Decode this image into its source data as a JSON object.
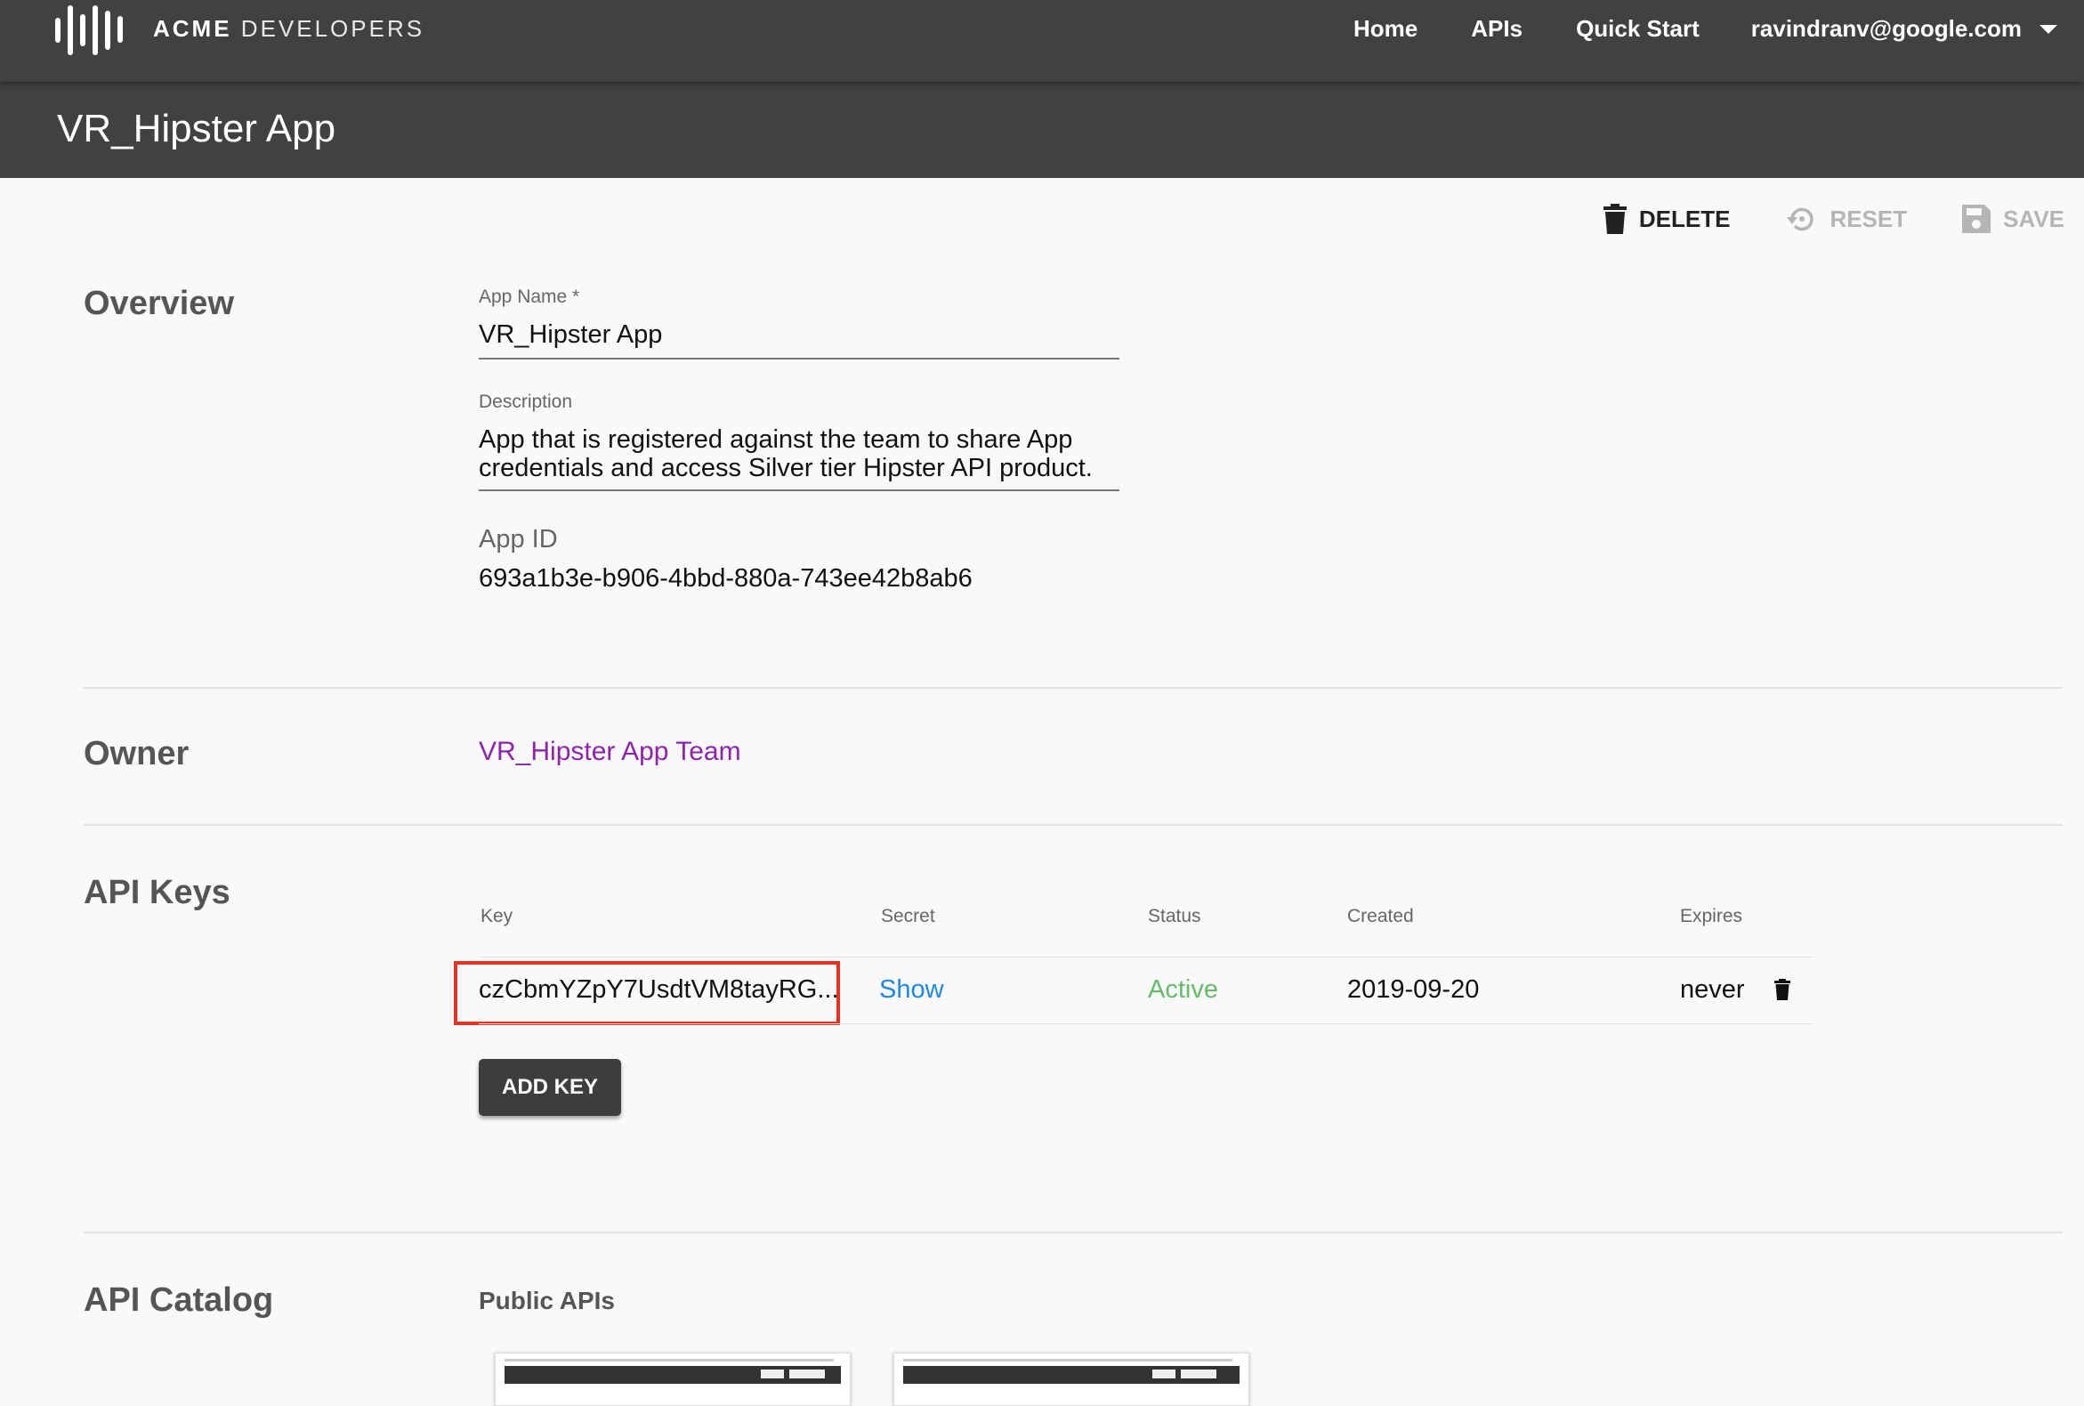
{
  "header": {
    "brand_bold": "ACME",
    "brand_thin": "DEVELOPERS",
    "nav": [
      "Home",
      "APIs",
      "Quick Start"
    ],
    "user_email": "ravindranv@google.com"
  },
  "page": {
    "title": "VR_Hipster App"
  },
  "actions": {
    "delete": "DELETE",
    "reset": "RESET",
    "save": "SAVE"
  },
  "overview": {
    "section_label": "Overview",
    "app_name_label": "App Name *",
    "app_name_value": "VR_Hipster App",
    "description_label": "Description",
    "description_line1": "App that is registered against the team to share App",
    "description_line2": "credentials and access Silver tier Hipster API product.",
    "app_id_label": "App ID",
    "app_id_value": "693a1b3e-b906-4bbd-880a-743ee42b8ab6"
  },
  "owner": {
    "section_label": "Owner",
    "team_link": "VR_Hipster App Team"
  },
  "api_keys": {
    "section_label": "API Keys",
    "columns": [
      "Key",
      "Secret",
      "Status",
      "Created",
      "Expires"
    ],
    "rows": [
      {
        "key": "czCbmYZpY7UsdtVM8tayRG...",
        "secret": "Show",
        "status": "Active",
        "created": "2019-09-20",
        "expires": "never"
      }
    ],
    "add_key_label": "ADD KEY"
  },
  "api_catalog": {
    "section_label": "API Catalog",
    "public_apis_label": "Public APIs"
  },
  "colors": {
    "header_bg": "#414141",
    "link_purple": "#8e24aa",
    "link_blue": "#1e88e5",
    "status_green": "#66bb6a",
    "highlight_red": "#e53323"
  }
}
